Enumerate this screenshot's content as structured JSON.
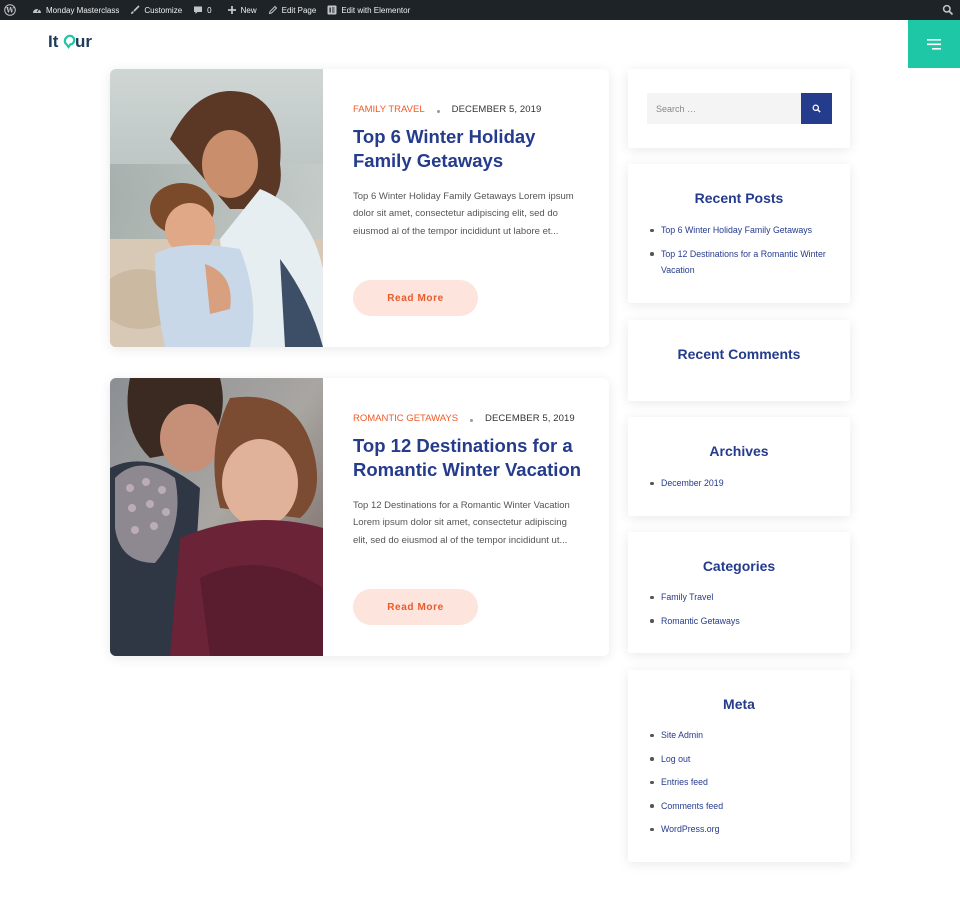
{
  "admin_bar": {
    "site_name": "Monday Masterclass",
    "customize": "Customize",
    "comments_count": "0",
    "new": "New",
    "edit_page": "Edit Page",
    "edit_elementor": "Edit with Elementor"
  },
  "brand": {
    "logo_text": "Itour",
    "accent": "#1ec7a6",
    "title_color": "#253b8c",
    "category_color": "#f05a28"
  },
  "posts": [
    {
      "category": "FAMILY TRAVEL",
      "date": "DECEMBER 5, 2019",
      "title": "Top 6 Winter Holiday Family Getaways",
      "excerpt": "Top 6 Winter Holiday Family Getaways Lorem ipsum dolor sit amet, consectetur adipiscing elit, sed do eiusmod al of the tempor incididunt ut labore et...",
      "read_more": "Read More"
    },
    {
      "category": "ROMANTIC GETAWAYS",
      "date": "DECEMBER 5, 2019",
      "title": "Top 12 Destinations for a Romantic Winter Vacation",
      "excerpt": "Top 12 Destinations for a Romantic Winter Vacation Lorem ipsum dolor sit amet, consectetur adipiscing elit, sed do eiusmod al of the tempor incididunt ut...",
      "read_more": "Read More"
    }
  ],
  "sidebar": {
    "search": {
      "placeholder": "Search …"
    },
    "recent_posts": {
      "title": "Recent Posts",
      "items": [
        "Top 6 Winter Holiday Family Getaways",
        "Top 12 Destinations for a Romantic Winter Vacation"
      ]
    },
    "recent_comments": {
      "title": "Recent Comments"
    },
    "archives": {
      "title": "Archives",
      "items": [
        "December 2019"
      ]
    },
    "categories": {
      "title": "Categories",
      "items": [
        "Family Travel",
        "Romantic Getaways"
      ]
    },
    "meta": {
      "title": "Meta",
      "items": [
        "Site Admin",
        "Log out",
        "Entries feed",
        "Comments feed",
        "WordPress.org"
      ]
    }
  }
}
